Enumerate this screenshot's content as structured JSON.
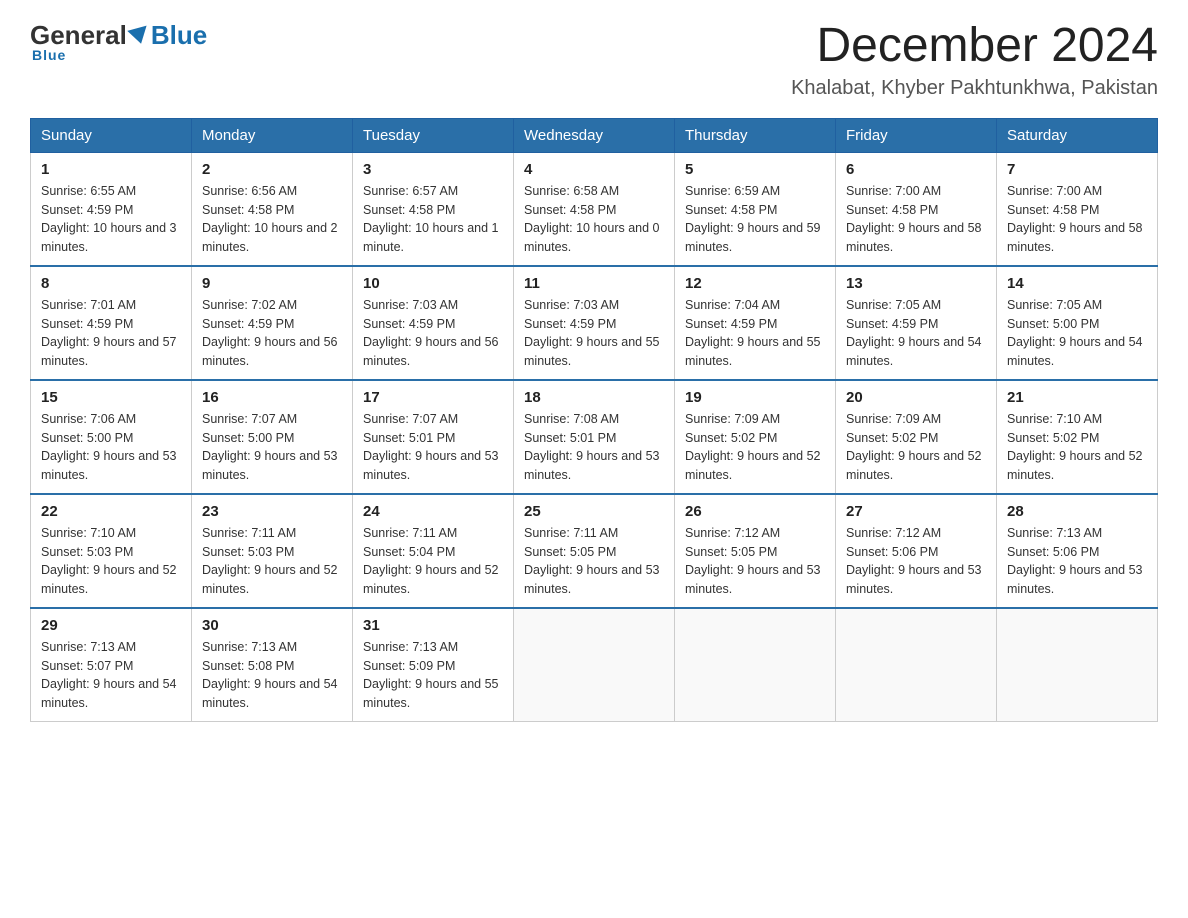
{
  "header": {
    "logo": {
      "part1": "General",
      "part2": "Blue"
    },
    "title": "December 2024",
    "subtitle": "Khalabat, Khyber Pakhtunkhwa, Pakistan"
  },
  "weekdays": [
    "Sunday",
    "Monday",
    "Tuesday",
    "Wednesday",
    "Thursday",
    "Friday",
    "Saturday"
  ],
  "weeks": [
    [
      {
        "day": "1",
        "sunrise": "6:55 AM",
        "sunset": "4:59 PM",
        "daylight": "10 hours and 3 minutes."
      },
      {
        "day": "2",
        "sunrise": "6:56 AM",
        "sunset": "4:58 PM",
        "daylight": "10 hours and 2 minutes."
      },
      {
        "day": "3",
        "sunrise": "6:57 AM",
        "sunset": "4:58 PM",
        "daylight": "10 hours and 1 minute."
      },
      {
        "day": "4",
        "sunrise": "6:58 AM",
        "sunset": "4:58 PM",
        "daylight": "10 hours and 0 minutes."
      },
      {
        "day": "5",
        "sunrise": "6:59 AM",
        "sunset": "4:58 PM",
        "daylight": "9 hours and 59 minutes."
      },
      {
        "day": "6",
        "sunrise": "7:00 AM",
        "sunset": "4:58 PM",
        "daylight": "9 hours and 58 minutes."
      },
      {
        "day": "7",
        "sunrise": "7:00 AM",
        "sunset": "4:58 PM",
        "daylight": "9 hours and 58 minutes."
      }
    ],
    [
      {
        "day": "8",
        "sunrise": "7:01 AM",
        "sunset": "4:59 PM",
        "daylight": "9 hours and 57 minutes."
      },
      {
        "day": "9",
        "sunrise": "7:02 AM",
        "sunset": "4:59 PM",
        "daylight": "9 hours and 56 minutes."
      },
      {
        "day": "10",
        "sunrise": "7:03 AM",
        "sunset": "4:59 PM",
        "daylight": "9 hours and 56 minutes."
      },
      {
        "day": "11",
        "sunrise": "7:03 AM",
        "sunset": "4:59 PM",
        "daylight": "9 hours and 55 minutes."
      },
      {
        "day": "12",
        "sunrise": "7:04 AM",
        "sunset": "4:59 PM",
        "daylight": "9 hours and 55 minutes."
      },
      {
        "day": "13",
        "sunrise": "7:05 AM",
        "sunset": "4:59 PM",
        "daylight": "9 hours and 54 minutes."
      },
      {
        "day": "14",
        "sunrise": "7:05 AM",
        "sunset": "5:00 PM",
        "daylight": "9 hours and 54 minutes."
      }
    ],
    [
      {
        "day": "15",
        "sunrise": "7:06 AM",
        "sunset": "5:00 PM",
        "daylight": "9 hours and 53 minutes."
      },
      {
        "day": "16",
        "sunrise": "7:07 AM",
        "sunset": "5:00 PM",
        "daylight": "9 hours and 53 minutes."
      },
      {
        "day": "17",
        "sunrise": "7:07 AM",
        "sunset": "5:01 PM",
        "daylight": "9 hours and 53 minutes."
      },
      {
        "day": "18",
        "sunrise": "7:08 AM",
        "sunset": "5:01 PM",
        "daylight": "9 hours and 53 minutes."
      },
      {
        "day": "19",
        "sunrise": "7:09 AM",
        "sunset": "5:02 PM",
        "daylight": "9 hours and 52 minutes."
      },
      {
        "day": "20",
        "sunrise": "7:09 AM",
        "sunset": "5:02 PM",
        "daylight": "9 hours and 52 minutes."
      },
      {
        "day": "21",
        "sunrise": "7:10 AM",
        "sunset": "5:02 PM",
        "daylight": "9 hours and 52 minutes."
      }
    ],
    [
      {
        "day": "22",
        "sunrise": "7:10 AM",
        "sunset": "5:03 PM",
        "daylight": "9 hours and 52 minutes."
      },
      {
        "day": "23",
        "sunrise": "7:11 AM",
        "sunset": "5:03 PM",
        "daylight": "9 hours and 52 minutes."
      },
      {
        "day": "24",
        "sunrise": "7:11 AM",
        "sunset": "5:04 PM",
        "daylight": "9 hours and 52 minutes."
      },
      {
        "day": "25",
        "sunrise": "7:11 AM",
        "sunset": "5:05 PM",
        "daylight": "9 hours and 53 minutes."
      },
      {
        "day": "26",
        "sunrise": "7:12 AM",
        "sunset": "5:05 PM",
        "daylight": "9 hours and 53 minutes."
      },
      {
        "day": "27",
        "sunrise": "7:12 AM",
        "sunset": "5:06 PM",
        "daylight": "9 hours and 53 minutes."
      },
      {
        "day": "28",
        "sunrise": "7:13 AM",
        "sunset": "5:06 PM",
        "daylight": "9 hours and 53 minutes."
      }
    ],
    [
      {
        "day": "29",
        "sunrise": "7:13 AM",
        "sunset": "5:07 PM",
        "daylight": "9 hours and 54 minutes."
      },
      {
        "day": "30",
        "sunrise": "7:13 AM",
        "sunset": "5:08 PM",
        "daylight": "9 hours and 54 minutes."
      },
      {
        "day": "31",
        "sunrise": "7:13 AM",
        "sunset": "5:09 PM",
        "daylight": "9 hours and 55 minutes."
      },
      null,
      null,
      null,
      null
    ]
  ],
  "labels": {
    "sunrise": "Sunrise:",
    "sunset": "Sunset:",
    "daylight": "Daylight:"
  }
}
